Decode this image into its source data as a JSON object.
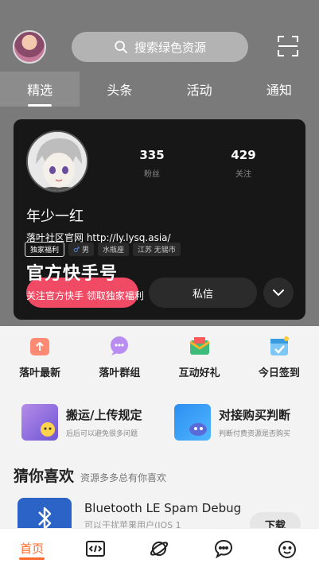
{
  "search": {
    "placeholder": "搜索绿色资源"
  },
  "tabs": [
    {
      "label": "精选",
      "active": true
    },
    {
      "label": "头条"
    },
    {
      "label": "活动"
    },
    {
      "label": "通知"
    }
  ],
  "profile": {
    "followers_count": "335",
    "followers_label": "粉丝",
    "following_count": "429",
    "following_label": "关注",
    "name": "年少一红",
    "site": "落叶社区官网 http://ly.lysq.asia/",
    "tags": [
      "独家福利",
      "男",
      "水瓶座",
      "江苏 无锡市"
    ],
    "big_title": "官方快手号",
    "subtitle": "关注官方快手  领取独家福利",
    "follow_button": "+ 关注",
    "message_button": "私信"
  },
  "entries": [
    {
      "label": "落叶最新",
      "icon": "upload-icon"
    },
    {
      "label": "落叶群组",
      "icon": "chat-group-icon"
    },
    {
      "label": "互动好礼",
      "icon": "gift-mail-icon"
    },
    {
      "label": "今日签到",
      "icon": "calendar-check-icon"
    }
  ],
  "features": [
    {
      "title": "搬运/上传规定",
      "desc": "后后可以避免很多问题"
    },
    {
      "title": "对接购买判断",
      "desc": "判断付费资源是否购买"
    }
  ],
  "section": {
    "title": "猜你喜欢",
    "subtitle": "资源多多总有你喜欢"
  },
  "app": {
    "name": "Bluetooth LE Spam Debug",
    "desc": "可以干扰苹果用户(IOS 1",
    "download": "下载"
  },
  "bottom_nav": [
    {
      "label": "首页",
      "active": true
    },
    {
      "icon": "code-icon"
    },
    {
      "icon": "planet-icon"
    },
    {
      "icon": "message-icon"
    },
    {
      "icon": "smile-icon"
    }
  ],
  "colors": {
    "accent": "#ff6a2c",
    "follow": "#f04a65"
  }
}
